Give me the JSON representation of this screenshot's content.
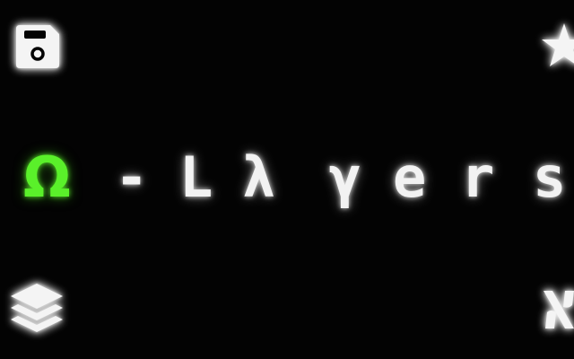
{
  "title": {
    "glyphs": [
      "Ω",
      "-",
      "L",
      "λ",
      "γ",
      "e",
      "r",
      "s"
    ]
  },
  "icons": {
    "top_left": "save-icon",
    "top_right": "star-icon",
    "bottom_left": "layers-icon",
    "bottom_right": "aleph-icon"
  },
  "colors": {
    "background": "#030303",
    "text": "#f2f2f2",
    "omega_accent": "#5af02a",
    "glow": "#ffffff"
  }
}
